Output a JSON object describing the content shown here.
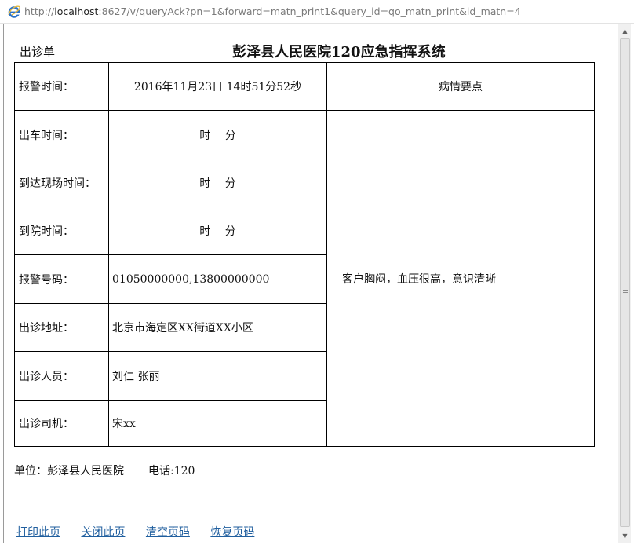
{
  "browser": {
    "url_prefix": "http://",
    "url_host": "localhost",
    "url_rest": ":8627/v/queryAck?pn=1&forward=matn_print1&query_id=qo_matn_print&id_matn=4",
    "icon": "ie-icon"
  },
  "document": {
    "label": "出诊单",
    "title": "彭泽县人民医院120应急指挥系统"
  },
  "table": {
    "rows": [
      {
        "label": "报警时间：",
        "value": "2016年11月23日  14时51分52秒"
      },
      {
        "label": "出车时间：",
        "value": "时　 分"
      },
      {
        "label": "到达现场时间：",
        "value": "时　 分"
      },
      {
        "label": "到院时间：",
        "value": "时　 分"
      },
      {
        "label": "报警号码：",
        "value": "01050000000,13800000000"
      },
      {
        "label": "出诊地址：",
        "value": "北京市海定区XX街道XX小区"
      },
      {
        "label": "出诊人员：",
        "value": "刘仁  张丽"
      },
      {
        "label": "出诊司机：",
        "value": "宋xx"
      }
    ],
    "notes_header": "病情要点",
    "notes_text": "客户胸闷，血压很高，意识清晰"
  },
  "footer": {
    "unit": "单位：彭泽县人民医院",
    "phone": "电话:120"
  },
  "links": {
    "print": "打印此页",
    "close": "关闭此页",
    "clear": "清空页码",
    "restore": "恢复页码"
  }
}
